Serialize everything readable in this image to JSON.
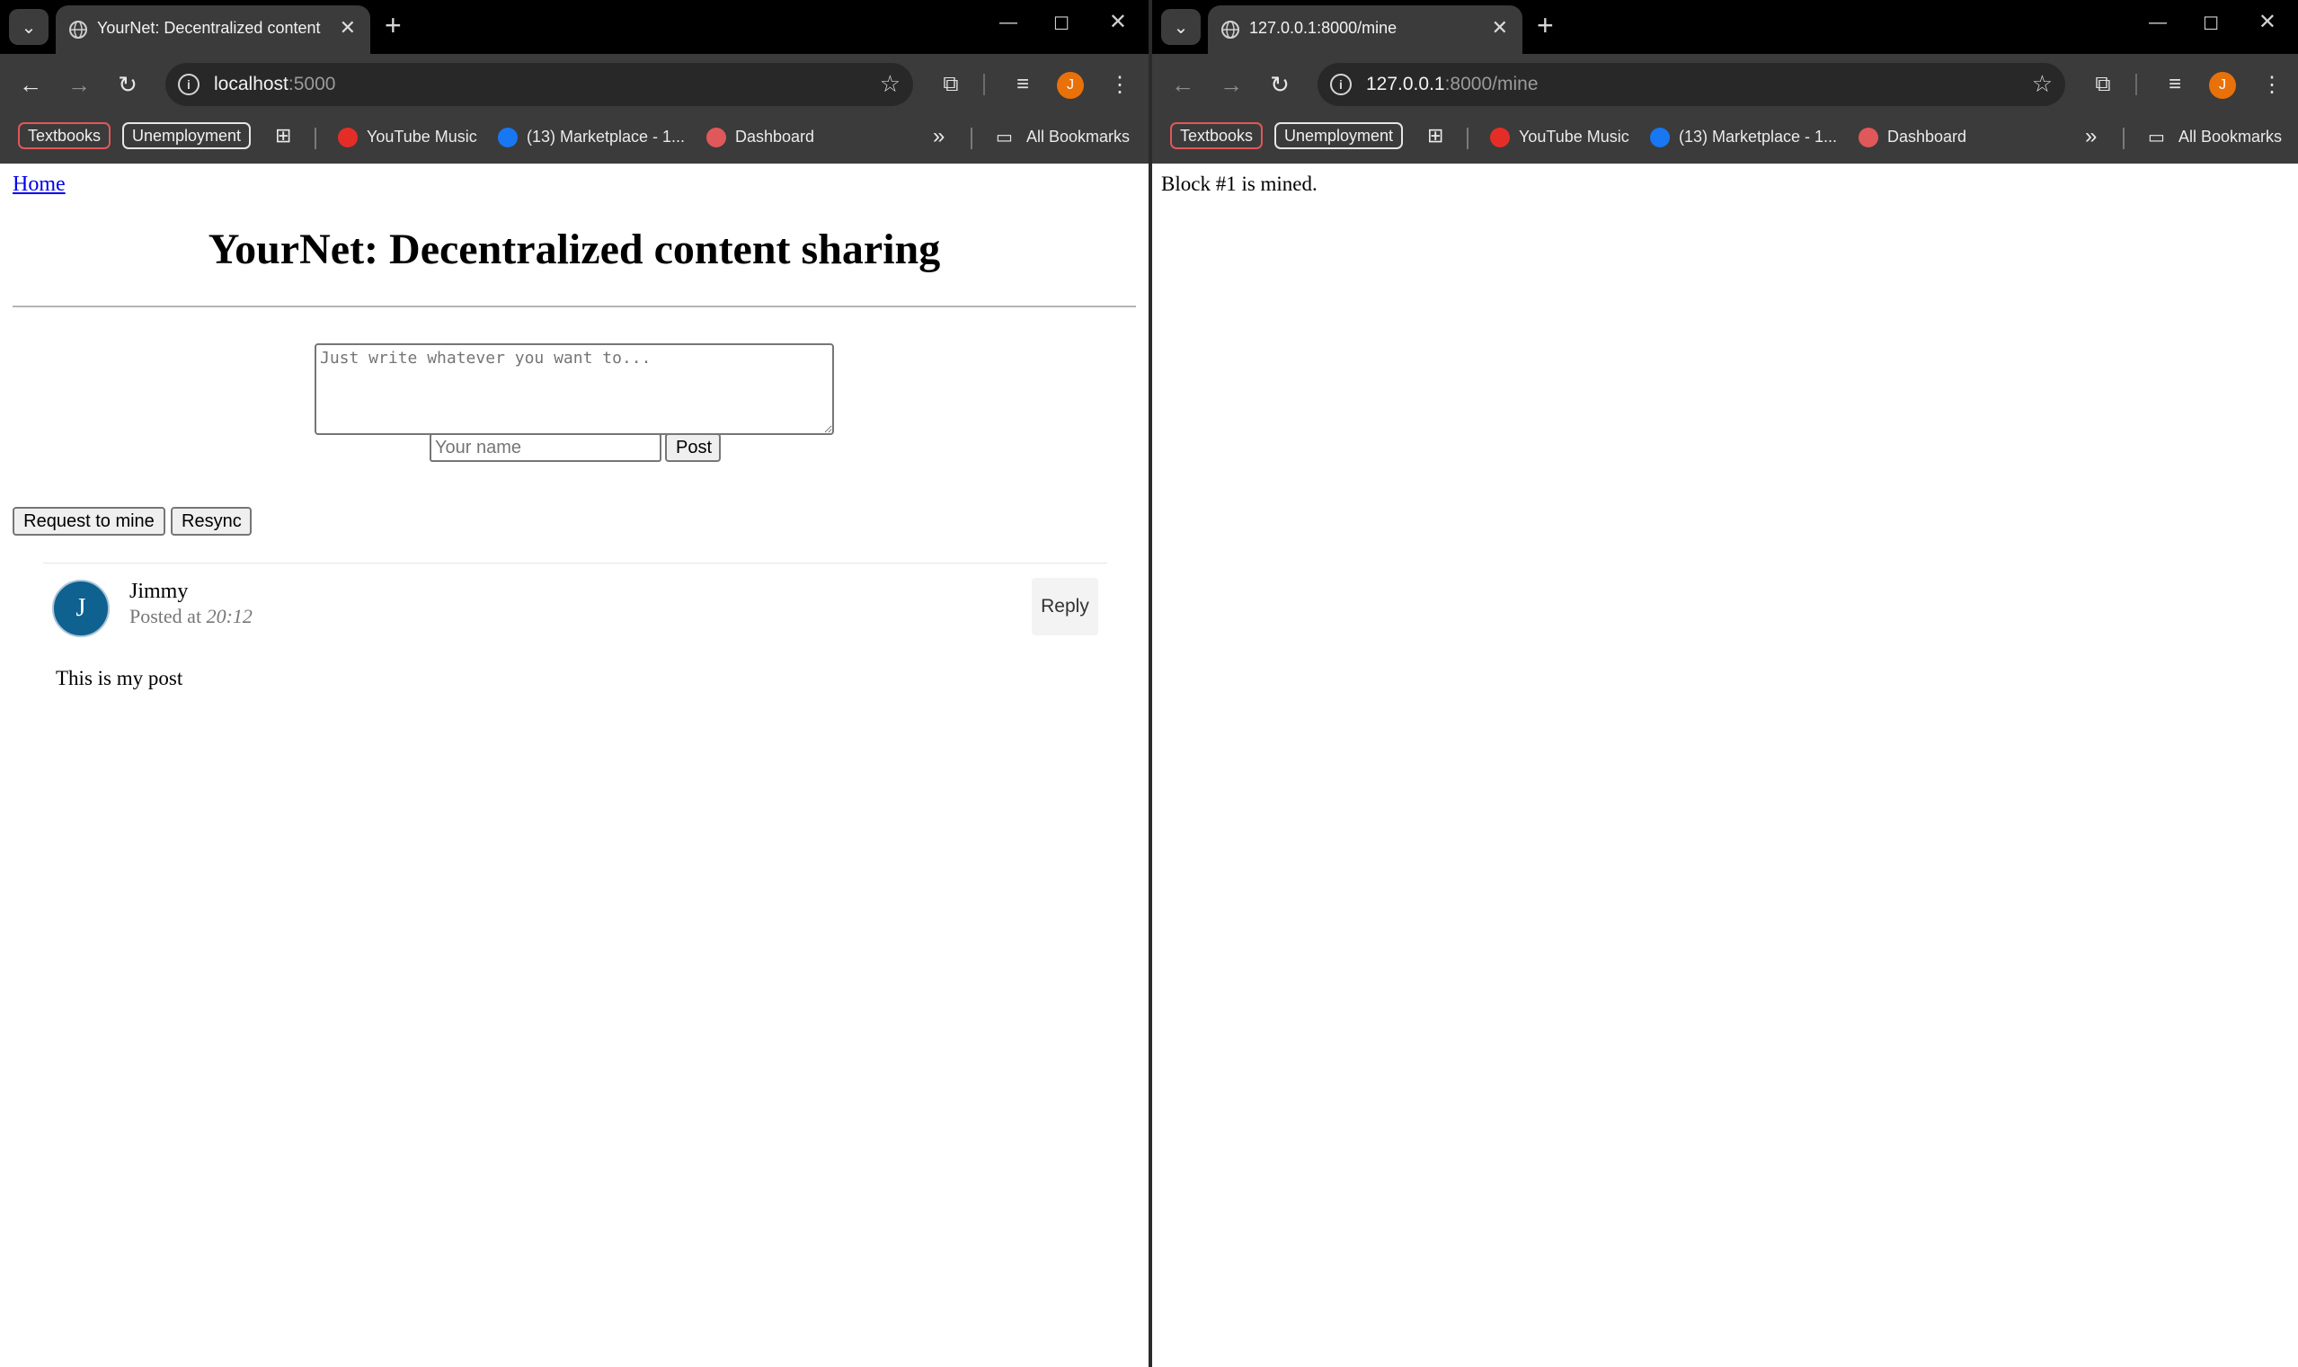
{
  "left": {
    "tab": {
      "title": "YourNet: Decentralized content sharing",
      "close": "✕"
    },
    "url": {
      "host": "localhost",
      "rest": ":5000"
    },
    "page": {
      "home_link": "Home",
      "title": "YourNet: Decentralized content sharing",
      "textarea_placeholder": "Just write whatever you want to...",
      "name_placeholder": "Your name",
      "post_button": "Post",
      "mine_button": "Request to mine",
      "resync_button": "Resync",
      "post": {
        "avatar_letter": "J",
        "author": "Jimmy",
        "posted_prefix": "Posted at",
        "posted_time": "20:12",
        "reply": "Reply",
        "body": "This is my post"
      }
    }
  },
  "right": {
    "tab": {
      "title": "127.0.0.1:8000/mine",
      "close": "✕"
    },
    "url": {
      "host": "127.0.0.1",
      "rest": ":8000/mine"
    },
    "page": {
      "message": "Block #1 is mined."
    }
  },
  "chrome": {
    "tab_search_icon": "chevron-down-icon",
    "new_tab": "+",
    "window_controls": {
      "minimize": "—",
      "maximize": "☐",
      "close": "✕"
    },
    "profile_letter": "J",
    "colors": {
      "profile": "#e8710a",
      "avatar": "#0f6190",
      "link": "#0000ee"
    }
  },
  "bookmarks": {
    "textbooks": "Textbooks",
    "unemployment": "Unemployment",
    "youtube_music": "YouTube Music",
    "marketplace": "(13) Marketplace - 1...",
    "dashboard": "Dashboard",
    "more": "»",
    "all_bookmarks": "All Bookmarks"
  }
}
